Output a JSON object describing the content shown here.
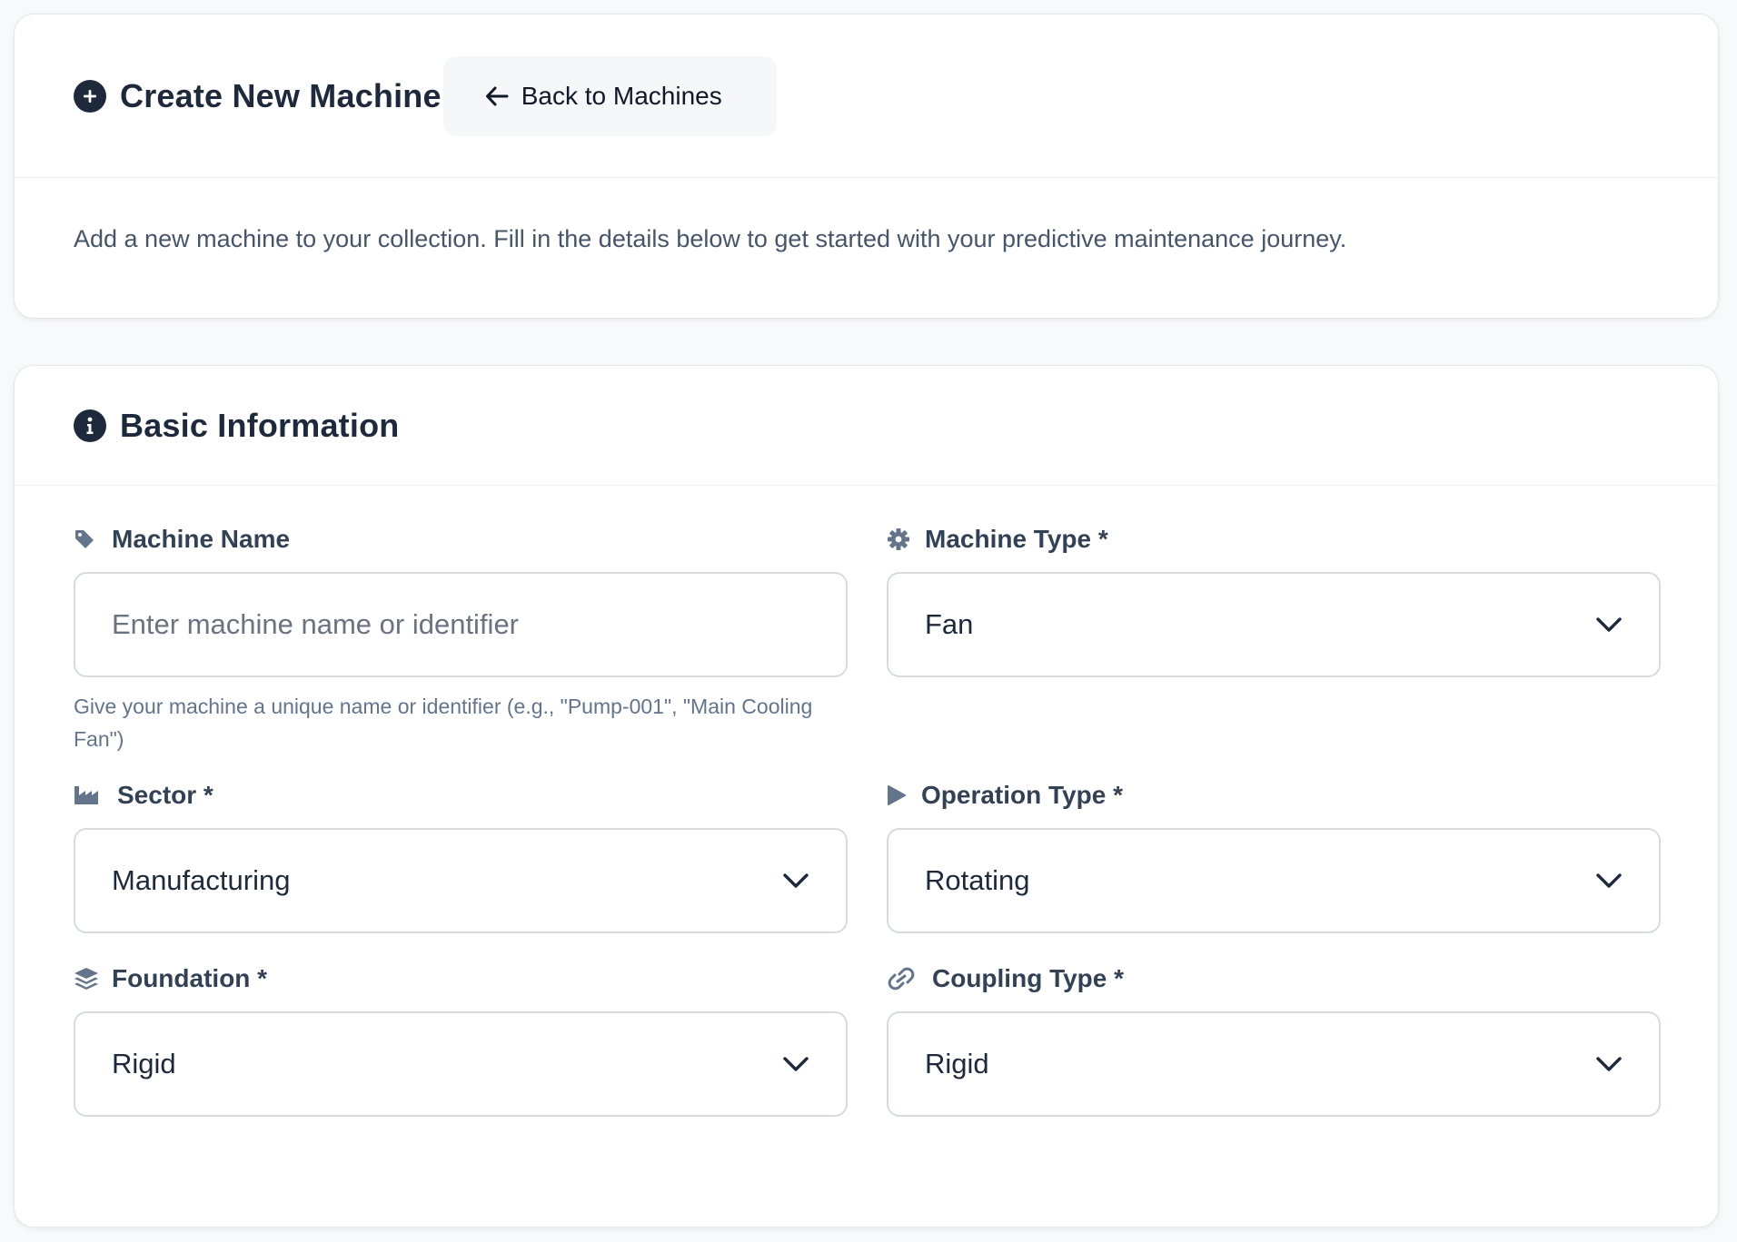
{
  "header": {
    "title": "Create New Machine",
    "title_icon": "plus-circle-icon",
    "back_label": "Back to Machines",
    "back_icon": "arrow-left-icon"
  },
  "intro": {
    "description": "Add a new machine to your collection. Fill in the details below to get started with your predictive maintenance journey."
  },
  "basic_info": {
    "title": "Basic Information",
    "title_icon": "info-circle-icon",
    "fields": {
      "machine_name": {
        "label": "Machine Name",
        "icon": "tag-icon",
        "value": "",
        "placeholder": "Enter machine name or identifier",
        "help": "Give your machine a unique name or identifier (e.g., \"Pump-001\", \"Main Cooling Fan\")"
      },
      "machine_type": {
        "label": "Machine Type *",
        "icon": "gear-icon",
        "value": "Fan"
      },
      "sector": {
        "label": "Sector *",
        "icon": "industry-icon",
        "value": "Manufacturing"
      },
      "operation_type": {
        "label": "Operation Type *",
        "icon": "play-icon",
        "value": "Rotating"
      },
      "foundation": {
        "label": "Foundation *",
        "icon": "layers-icon",
        "value": "Rigid"
      },
      "coupling_type": {
        "label": "Coupling Type *",
        "icon": "link-icon",
        "value": "Rigid"
      }
    }
  },
  "colors": {
    "background": "#f8f9fb",
    "card": "#ffffff",
    "heading": "#1e293b",
    "label": "#334155",
    "muted": "#64748b",
    "border": "#d7dbe0"
  }
}
